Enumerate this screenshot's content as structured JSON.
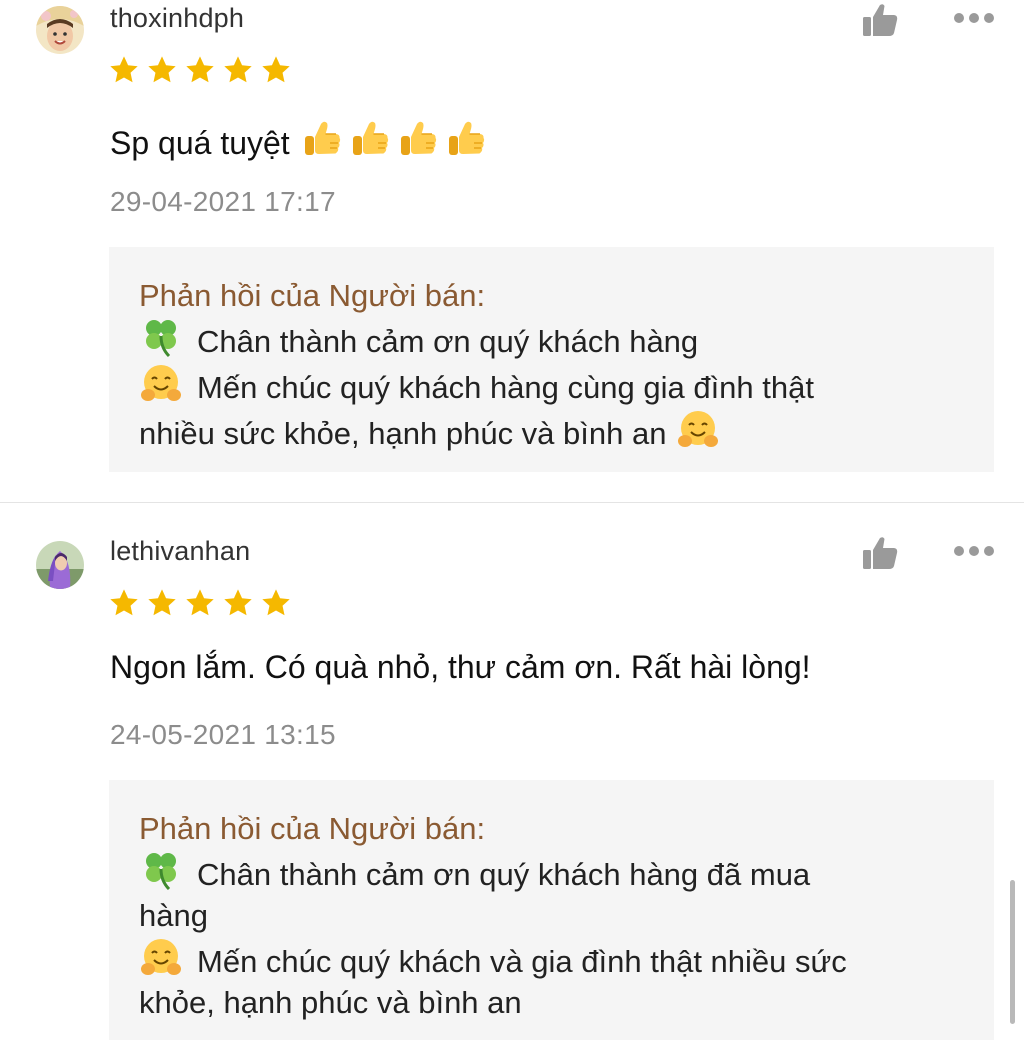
{
  "reviews": [
    {
      "username": "thoxinhdph",
      "rating": 5,
      "comment": "Sp quá tuyệt",
      "thumbs_emoji_count": 4,
      "timestamp": "29-04-2021 17:17",
      "reply": {
        "title": "Phản hồi của Người bán:",
        "line1": "Chân thành cảm ơn quý khách hàng",
        "line2": "Mến chúc quý khách hàng cùng gia đình thật",
        "line3": "nhiều sức khỏe, hạnh phúc và bình an"
      }
    },
    {
      "username": "lethivanhan",
      "rating": 5,
      "comment": "Ngon lắm. Có quà nhỏ, thư cảm ơn. Rất hài lòng!",
      "timestamp": "24-05-2021 13:15",
      "reply": {
        "title": "Phản hồi của Người bán:",
        "line1": "Chân thành cảm ơn quý khách hàng đã mua",
        "line1b": "hàng",
        "line2": "Mến chúc quý khách và gia đình thật nhiều sức",
        "line3": "khỏe, hạnh phúc và bình an"
      }
    }
  ],
  "icons": {
    "star": "star-icon",
    "like": "thumbs-up-icon",
    "more": "more-options-icon",
    "clover": "four-leaf-clover-emoji",
    "hug": "hugging-face-emoji"
  },
  "colors": {
    "star": "#f5b800",
    "reply_title": "#8a5a32",
    "timestamp": "#8c8c8c",
    "reply_bg": "#f5f5f5",
    "icon_gray": "#9a9a9a"
  }
}
